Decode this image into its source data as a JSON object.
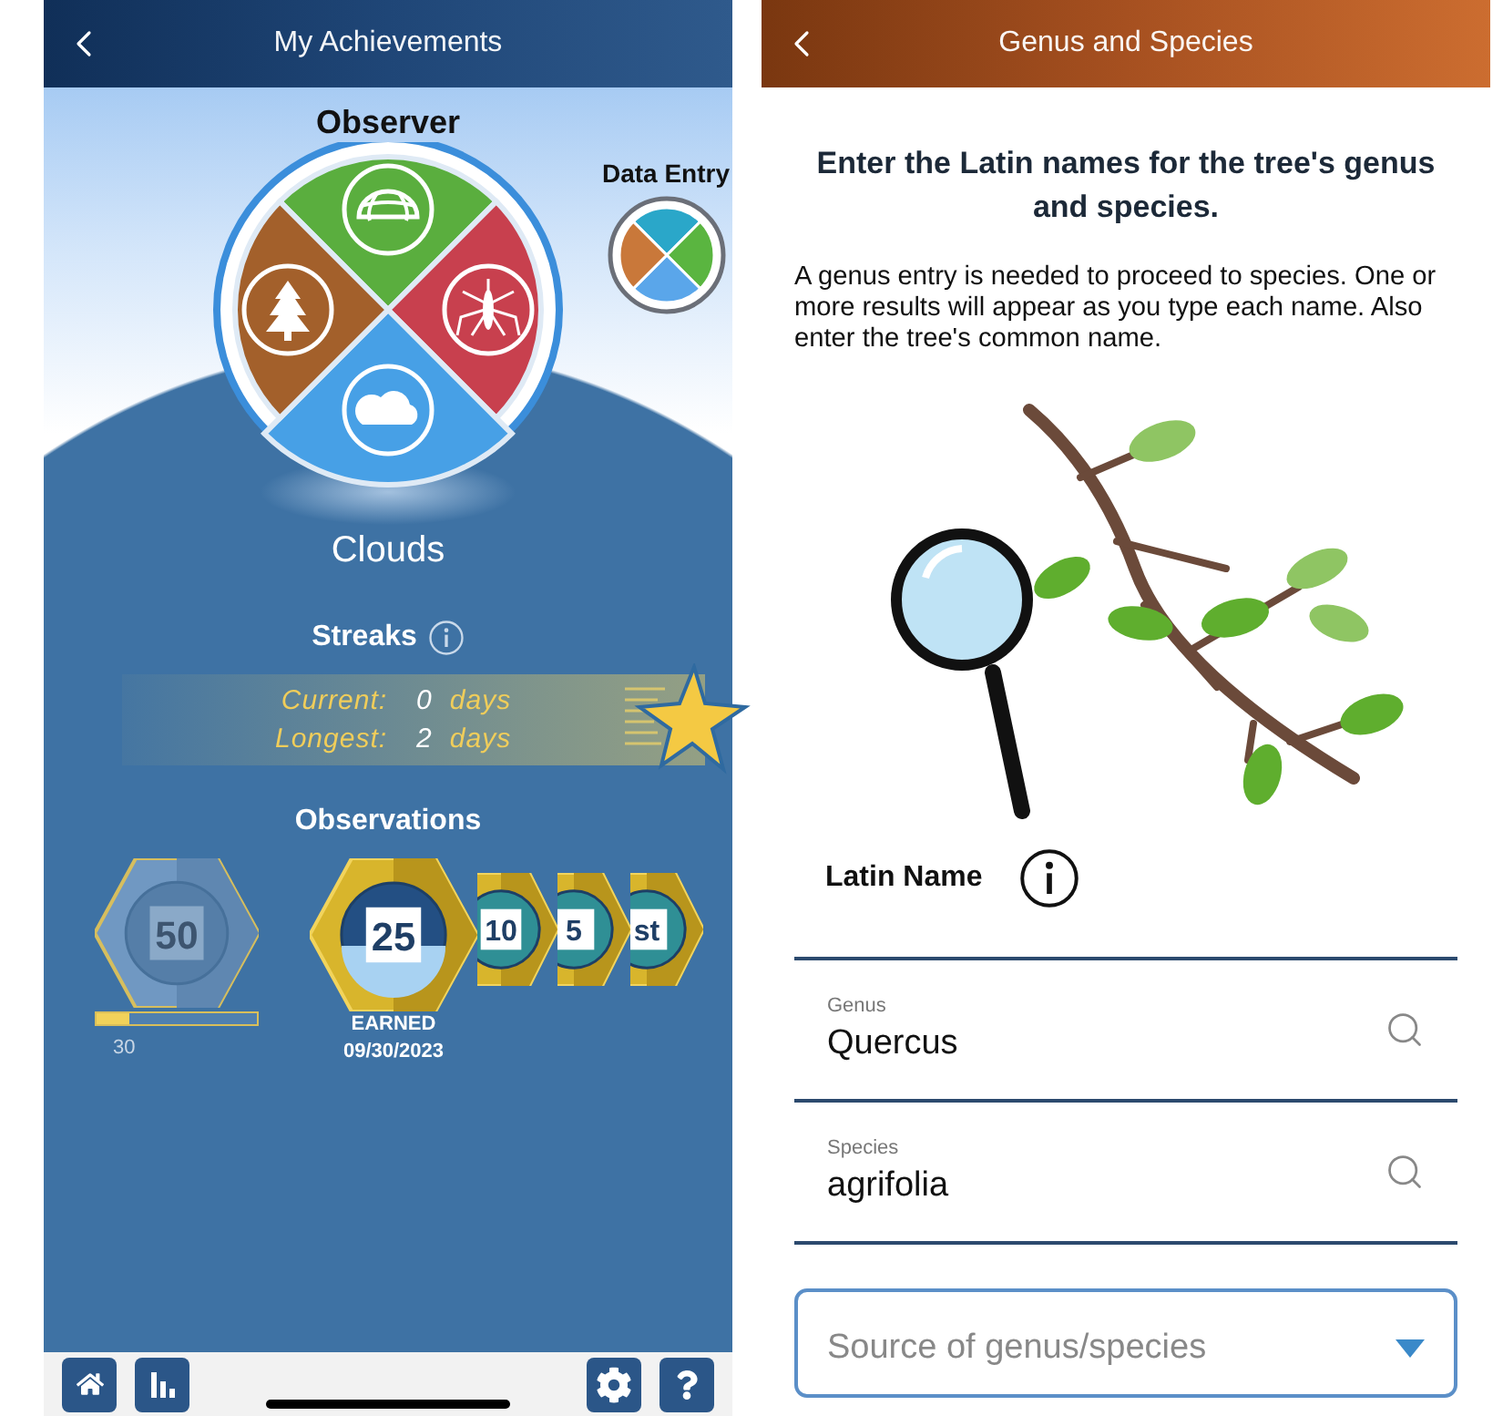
{
  "left": {
    "header": {
      "title": "My Achievements"
    },
    "level_title": "Observer",
    "wheel": {
      "segments": [
        {
          "kind": "globe",
          "color": "#5aae3e",
          "selected": false
        },
        {
          "kind": "mosquito",
          "color": "#c8404e",
          "selected": false
        },
        {
          "kind": "cloud",
          "color": "#47a0e6",
          "selected": true
        },
        {
          "kind": "tree",
          "color": "#a3602b",
          "selected": false
        }
      ]
    },
    "data_entry": {
      "label": "Data Entry"
    },
    "selected_category": "Clouds",
    "streaks": {
      "title": "Streaks",
      "rows": [
        {
          "label": "Current:",
          "value": "0",
          "unit": "days"
        },
        {
          "label": "Longest:",
          "value": "2",
          "unit": "days"
        }
      ]
    },
    "observations": {
      "title": "Observations",
      "badges": [
        {
          "kind": "next",
          "number": "50",
          "earned": false,
          "level": 0.2,
          "count": "30"
        },
        {
          "kind": "latest",
          "number": "25",
          "earned": true,
          "status": "EARNED",
          "date": "09/30/2023"
        },
        {
          "kind": "stack",
          "number": "10",
          "earned": true
        },
        {
          "kind": "stack",
          "number": "5",
          "earned": true
        },
        {
          "kind": "stack",
          "number": "st",
          "earned": true
        }
      ]
    }
  },
  "right": {
    "header": {
      "title": "Genus and Species"
    },
    "heading": "Enter the Latin names for the tree's genus and species.",
    "instructions": "A genus entry is needed to proceed to species. One or more results will appear as you type each name. Also enter the tree's common name.",
    "section": {
      "label": "Latin Name"
    },
    "fields": [
      {
        "label": "Genus",
        "value": "Quercus"
      },
      {
        "label": "Species",
        "value": "agrifolia"
      }
    ],
    "source_select": {
      "placeholder": "Source of genus/species"
    }
  }
}
